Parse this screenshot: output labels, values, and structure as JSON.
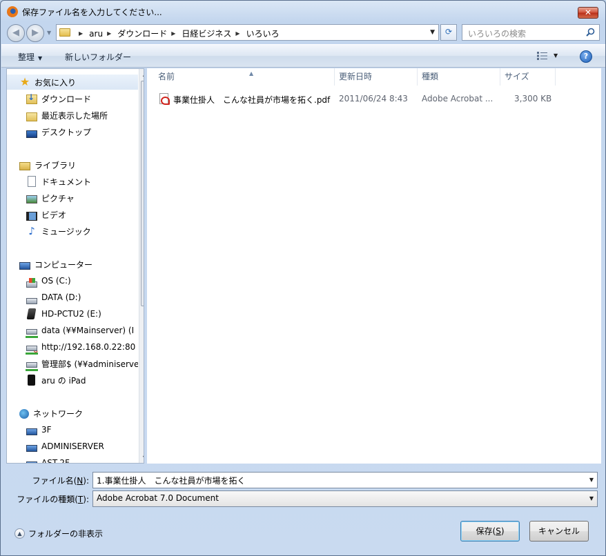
{
  "window": {
    "title": "保存ファイル名を入力してください...",
    "close_label": "✕"
  },
  "address": {
    "crumbs": [
      "aru",
      "ダウンロード",
      "日経ビジネス",
      "いろいろ"
    ],
    "search_placeholder": "いろいろの検索"
  },
  "toolbar": {
    "organize": "整理",
    "new_folder": "新しいフォルダー",
    "help": "?"
  },
  "sidebar": {
    "favorites": {
      "label": "お気に入り",
      "items": [
        "ダウンロード",
        "最近表示した場所",
        "デスクトップ"
      ]
    },
    "libraries": {
      "label": "ライブラリ",
      "items": [
        "ドキュメント",
        "ピクチャ",
        "ビデオ",
        "ミュージック"
      ]
    },
    "computer": {
      "label": "コンピューター",
      "items": [
        "OS (C:)",
        "DATA (D:)",
        "HD-PCTU2 (E:)",
        "data (¥¥Mainserver) (I",
        "http://192.168.0.22:80",
        "管理部$ (¥¥adminiserve",
        "aru の iPad"
      ]
    },
    "network": {
      "label": "ネットワーク",
      "items": [
        "3F",
        "ADMINISERVER",
        "AST-2F"
      ]
    }
  },
  "columns": [
    "名前",
    "更新日時",
    "種類",
    "サイズ"
  ],
  "files": [
    {
      "name": "事業仕掛人　こんな社員が市場を拓く.pdf",
      "modified": "2011/06/24 8:43",
      "type": "Adobe Acrobat ...",
      "size": "3,300 KB"
    }
  ],
  "form": {
    "filename_label": "ファイル名(",
    "filename_key": "N",
    "filename_suffix": "):",
    "filename_value": "1.事業仕掛人　こんな社員が市場を拓く",
    "filetype_label": "ファイルの種類(",
    "filetype_key": "T",
    "filetype_suffix": "):",
    "filetype_value": "Adobe Acrobat 7.0 Document"
  },
  "footer": {
    "hide_folders": "フォルダーの非表示",
    "save_label": "保存(",
    "save_key": "S",
    "save_suffix": ")",
    "cancel_label": "キャンセル"
  }
}
